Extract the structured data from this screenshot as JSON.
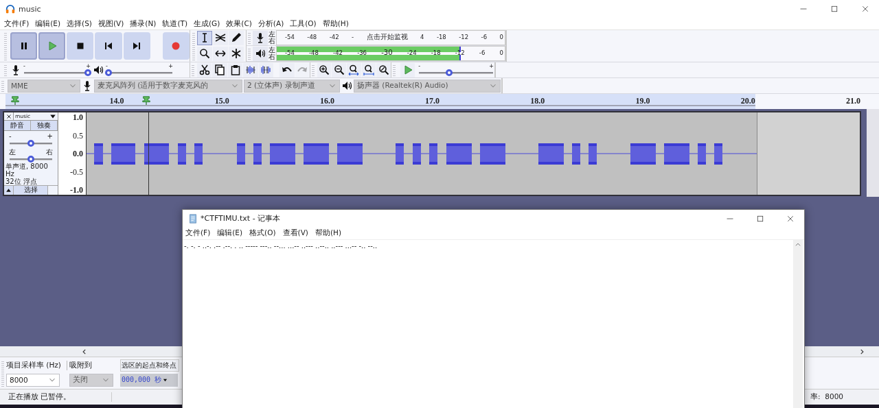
{
  "window": {
    "title": "music"
  },
  "menu": [
    "文件(F)",
    "编辑(E)",
    "选择(S)",
    "视图(V)",
    "播录(N)",
    "轨道(T)",
    "生成(G)",
    "效果(C)",
    "分析(A)",
    "工具(O)",
    "帮助(H)"
  ],
  "transport": [
    {
      "kind": "pause",
      "pressed": true
    },
    {
      "kind": "play",
      "pressed": true
    },
    {
      "kind": "stop",
      "pressed": false
    },
    {
      "kind": "skip_start",
      "pressed": false
    },
    {
      "kind": "skip_end",
      "pressed": false
    },
    {
      "kind": "record",
      "pressed": false
    }
  ],
  "tools": [
    {
      "kind": "select",
      "selected": true
    },
    {
      "kind": "envelope",
      "selected": false
    },
    {
      "kind": "draw",
      "selected": false
    },
    {
      "kind": "zoom",
      "selected": false
    },
    {
      "kind": "time_shift",
      "selected": false
    },
    {
      "kind": "multi",
      "selected": false
    }
  ],
  "meters": [
    {
      "kind": "record",
      "channels": [
        "左",
        "右"
      ],
      "scale": [
        "-54",
        "-48",
        "-42",
        "-",
        "点击开始监视",
        "4",
        "-18",
        "-12",
        "-6",
        "0"
      ]
    },
    {
      "kind": "playback",
      "channels": [
        "左",
        "右"
      ],
      "scale": [
        "-54",
        "-48",
        "-42",
        "-36",
        "-30",
        "-24",
        "-18",
        "-12",
        "-6",
        "0"
      ],
      "level": 0.8
    }
  ],
  "mixer": {
    "record_volume": {
      "min_label": "-",
      "max_label": "+",
      "level": 1
    },
    "playback_volume": {
      "min_label": "-",
      "max_label": "+",
      "level": 0
    }
  },
  "edit_buttons": [
    {
      "kind": "cut",
      "disabled": false
    },
    {
      "kind": "copy",
      "disabled": false
    },
    {
      "kind": "paste",
      "disabled": false
    },
    {
      "kind": "trim",
      "disabled": false
    },
    {
      "kind": "silence",
      "disabled": false
    },
    {
      "kind": "undo",
      "disabled": false
    },
    {
      "kind": "redo",
      "disabled": true
    }
  ],
  "zoom_buttons": [
    {
      "kind": "zoom_in",
      "disabled": false
    },
    {
      "kind": "zoom_out",
      "disabled": false
    },
    {
      "kind": "fit_selection",
      "disabled": false
    },
    {
      "kind": "fit_project",
      "disabled": false
    },
    {
      "kind": "zoom_toggle",
      "disabled": false
    }
  ],
  "play_at_speed": {
    "min_label": "-",
    "max_label": "+",
    "level": 0.4
  },
  "devices": {
    "host": "MME",
    "recording_device": "麦克风阵列 (适用于数字麦克风的",
    "channels": "2 (立体声) 录制声道",
    "playback_device": "扬声器 (Realtek(R) Audio)"
  },
  "timeline": {
    "labels": [
      "14.0",
      "15.0",
      "16.0",
      "17.0",
      "18.0",
      "19.0",
      "20.0",
      "21.0"
    ]
  },
  "track": {
    "name": "music",
    "mute": "静音",
    "solo": "独奏",
    "gain": {
      "min_label": "-",
      "max_label": "+",
      "level": 0.5
    },
    "pan": {
      "min_label": "左",
      "max_label": "右",
      "level": 0.5
    },
    "info": [
      "单声道, 8000 Hz",
      "32位 浮点"
    ],
    "select": "选择",
    "scale": [
      {
        "label": "1.0",
        "major": true
      },
      {
        "label": "0.5",
        "major": false
      },
      {
        "label": "0.0",
        "major": true
      },
      {
        "label": "-0.5",
        "major": false
      },
      {
        "label": "-1.0",
        "major": true
      }
    ]
  },
  "selection_toolbar": {
    "rate_label": "项目采样率 (Hz)",
    "snap_label": "吸附到",
    "selection_label": "选区的起点和终点",
    "rate": "8000",
    "snap": "关闭",
    "time": "000,000 秒"
  },
  "status_bar": {
    "state": "正在播放 已暂停。",
    "rate": "率:  8000"
  },
  "notepad": {
    "title": "*CTFTIMU.txt - 记事本",
    "menu": [
      "文件(F)",
      "编辑(E)",
      "格式(O)",
      "查看(V)",
      "帮助(H)"
    ],
    "text": "-. -. - ..-. .-- .--. . .. ----- ---.. --... ...-- ..--- ..--.. ..--- ...-- -.. --.."
  }
}
